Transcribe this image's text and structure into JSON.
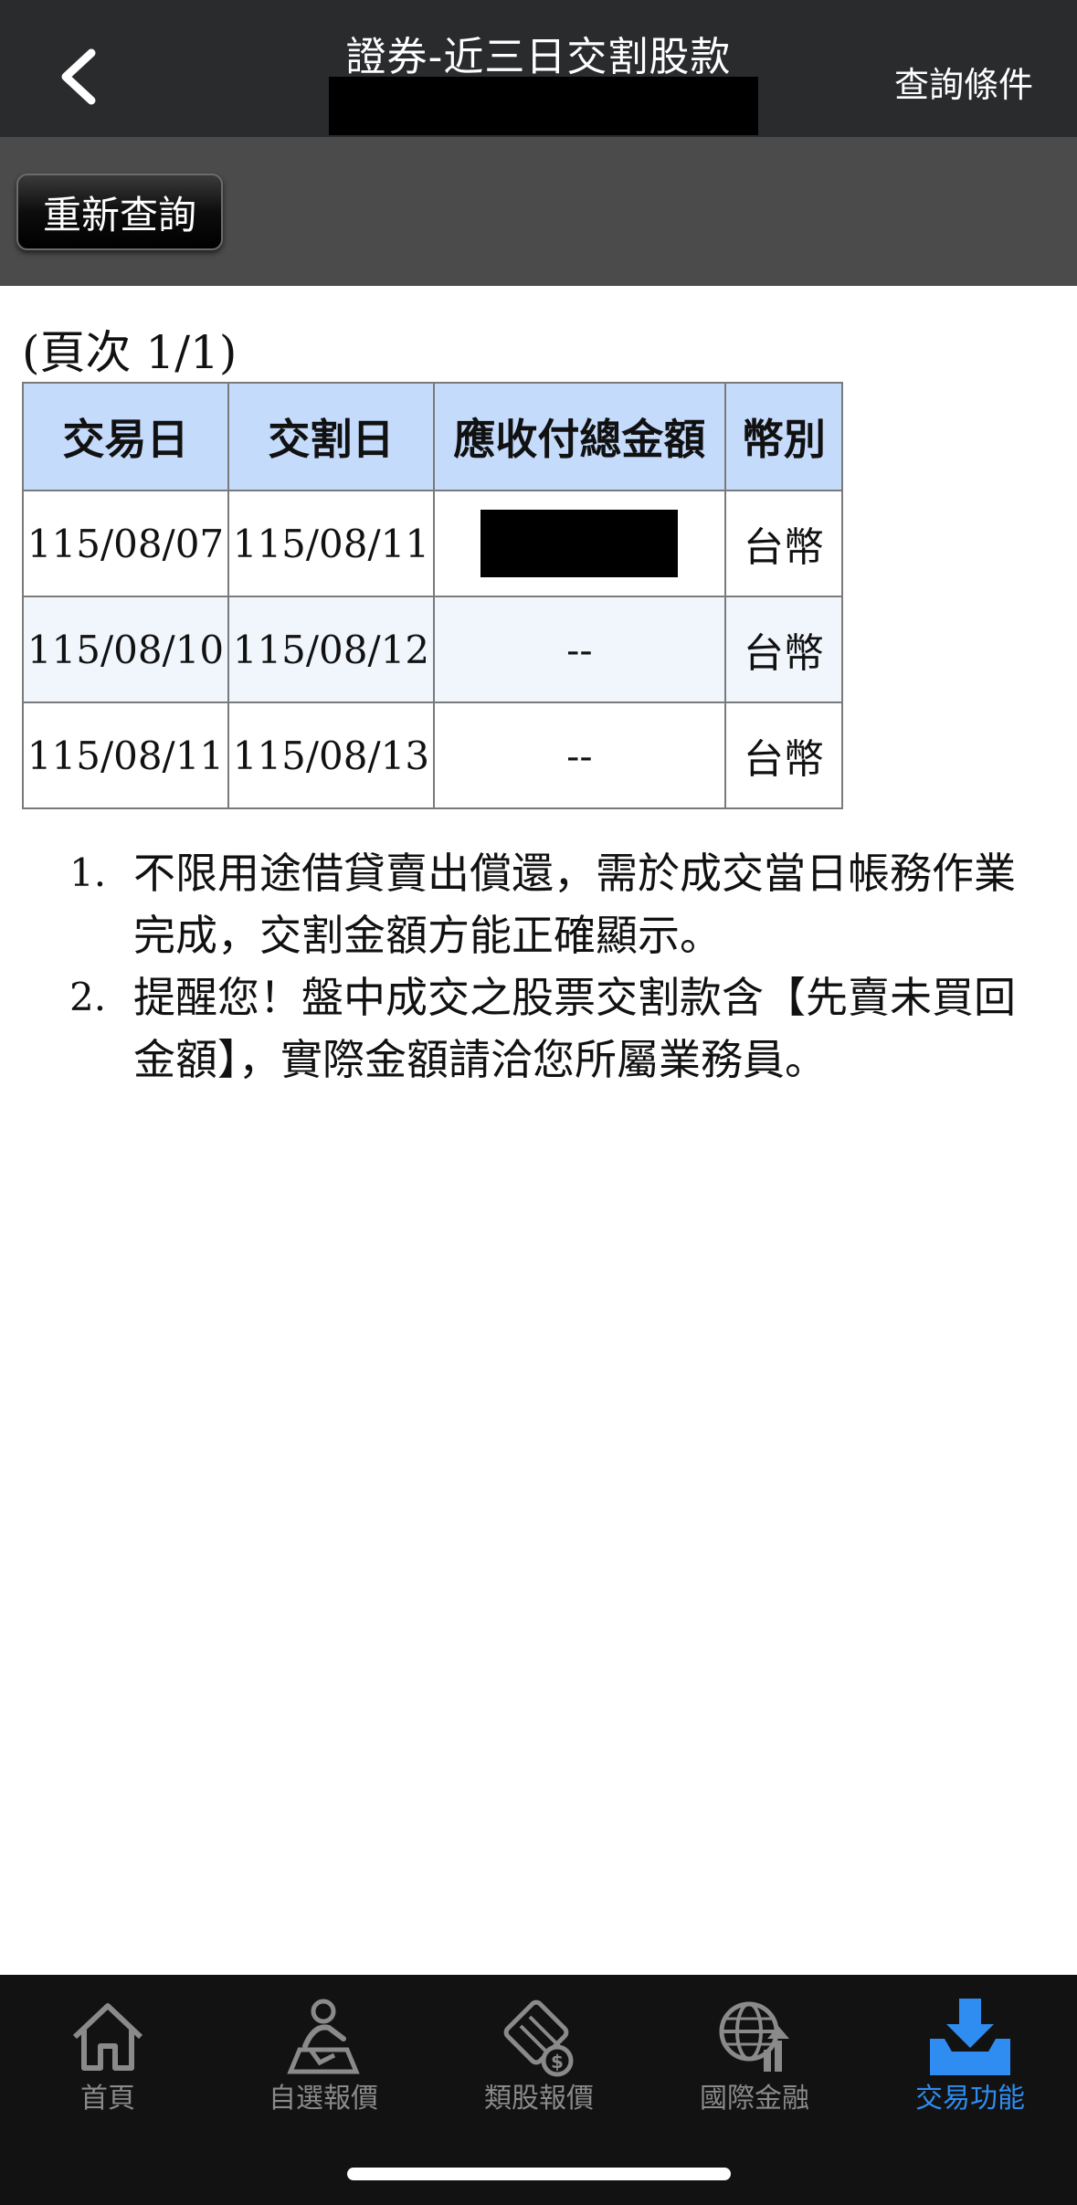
{
  "header": {
    "title": "證券-近三日交割股款",
    "right_action": "查詢條件"
  },
  "toolbar": {
    "requery_label": "重新查詢"
  },
  "page_indicator": "(頁次 1/1)",
  "table": {
    "headers": [
      "交易日",
      "交割日",
      "應收付總金額",
      "幣別"
    ],
    "rows": [
      {
        "trade_date": "115/08/07",
        "settle_date": "115/08/11",
        "amount": "",
        "currency": "台幣"
      },
      {
        "trade_date": "115/08/10",
        "settle_date": "115/08/12",
        "amount": "--",
        "currency": "台幣"
      },
      {
        "trade_date": "115/08/11",
        "settle_date": "115/08/13",
        "amount": "--",
        "currency": "台幣"
      }
    ]
  },
  "notes": [
    {
      "num": "1.",
      "text": "不限用途借貸賣出償還，需於成交當日帳務作業完成，交割金額方能正確顯示。"
    },
    {
      "num": "2.",
      "text": "提醒您！盤中成交之股票交割款含【先賣未買回金額】，實際金額請洽您所屬業務員。"
    }
  ],
  "bottom_nav": {
    "items": [
      {
        "label": "首頁",
        "icon": "home-icon",
        "active": false
      },
      {
        "label": "自選報價",
        "icon": "watchlist-person-icon",
        "active": false
      },
      {
        "label": "類股報價",
        "icon": "film-dollar-icon",
        "active": false
      },
      {
        "label": "國際金融",
        "icon": "globe-chart-icon",
        "active": false
      },
      {
        "label": "交易功能",
        "icon": "tray-download-icon",
        "active": true
      }
    ],
    "active_color": "#2f8cf0",
    "inactive_color": "#8a8a8a"
  }
}
